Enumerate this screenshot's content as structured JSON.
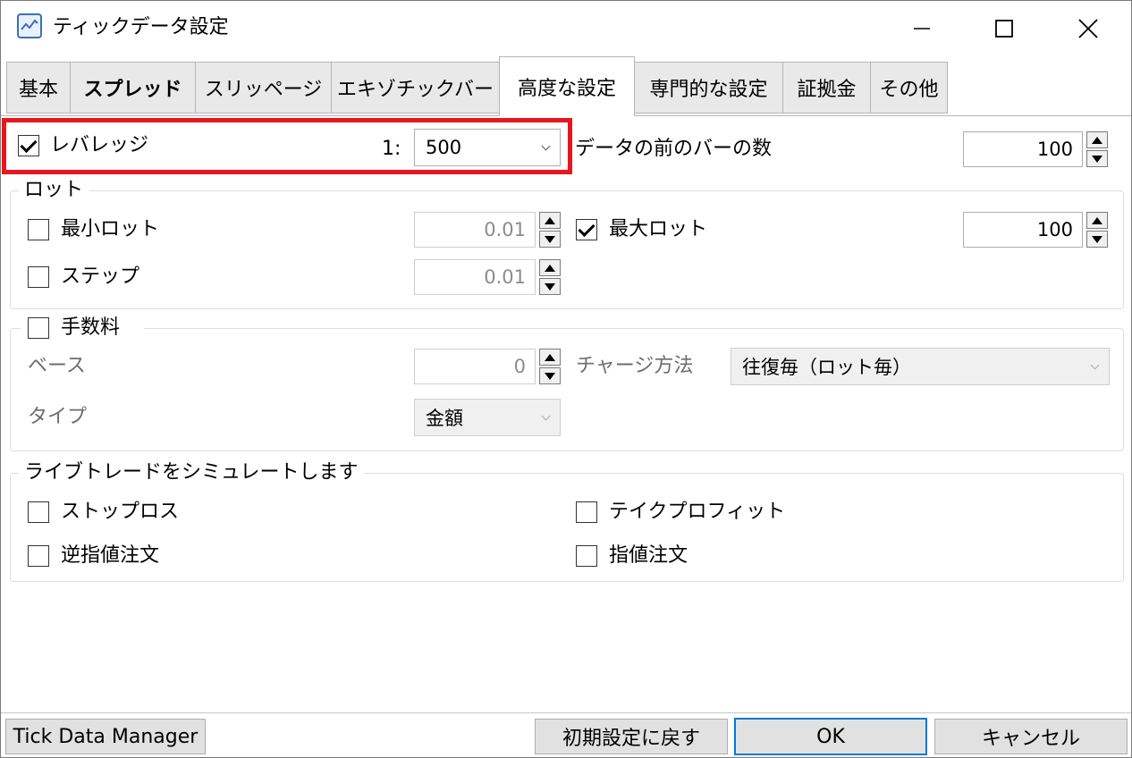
{
  "window": {
    "title": "ティックデータ設定",
    "icon": "chart-window-icon",
    "controls": [
      "minimize-icon",
      "maximize-icon",
      "close-icon"
    ]
  },
  "tabs": [
    {
      "label": "基本"
    },
    {
      "label": "スプレッド"
    },
    {
      "label": "スリッページ"
    },
    {
      "label": "エキゾチックバー"
    },
    {
      "label": "高度な設定",
      "active": true
    },
    {
      "label": "専門的な設定"
    },
    {
      "label": "証拠金"
    },
    {
      "label": "その他"
    }
  ],
  "leverage": {
    "label": "レバレッジ",
    "checked": true,
    "prefix": "1:",
    "value": "500"
  },
  "bars_before": {
    "label": "データの前のバーの数",
    "value": "100"
  },
  "lot": {
    "title": "ロット",
    "min_label": "最小ロット",
    "min_checked": false,
    "min_value": "0.01",
    "max_label": "最大ロット",
    "max_checked": true,
    "max_value": "100",
    "step_label": "ステップ",
    "step_checked": false,
    "step_value": "0.01"
  },
  "commission": {
    "title": "手数料",
    "checked": false,
    "base_label": "ベース",
    "base_value": "0",
    "charge_label": "チャージ方法",
    "charge_value": "往復毎（ロット毎）",
    "type_label": "タイプ",
    "type_value": "金額"
  },
  "simulate": {
    "title": "ライブトレードをシミュレートします",
    "stop_loss": "ストップロス",
    "take_profit": "テイクプロフィット",
    "stop_order": "逆指値注文",
    "limit_order": "指値注文"
  },
  "buttons": {
    "tick_data_manager": "Tick Data Manager",
    "reset": "初期設定に戻す",
    "ok": "OK",
    "cancel": "キャンセル"
  },
  "colors": {
    "highlight": "#e8161e",
    "accent": "#0078d7"
  }
}
